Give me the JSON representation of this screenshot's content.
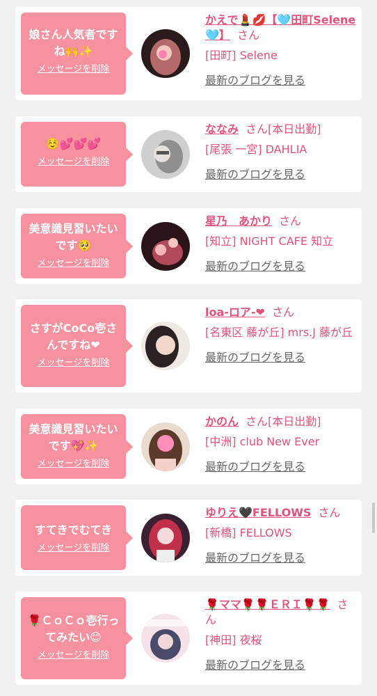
{
  "delete_label": "メッセージを削除",
  "blog_label": "最新のブログを見る",
  "honorific": "さん",
  "accent_color": "#e0537a",
  "bubble_color": "#f6919f",
  "items": [
    {
      "message": "娘さん人気者ですね🙌✨",
      "name": "かえで💄💋【🩵田町Selene🩵】",
      "status": "",
      "shop": "[田町] Selene"
    },
    {
      "message": "☺️💕💕💕",
      "name": "ななみ",
      "status": "[本日出勤]",
      "shop": "[尾張 一宮] DAHLIA"
    },
    {
      "message": "美意識見習いたいです🥺",
      "name": "星乃　あかり",
      "status": "",
      "shop": "[知立] NIGHT CAFE 知立"
    },
    {
      "message": "さすがCoCo壱さんですね❤",
      "name": "loa-ロア-❤",
      "status": "",
      "shop": "[名東区 藤が丘] mrs.J 藤が丘"
    },
    {
      "message": "美意識見習いたいです💖✨",
      "name": "かのん",
      "status": "[本日出勤]",
      "shop": "[中洲] club New Ever"
    },
    {
      "message": "すてきでむてき",
      "name": "ゆりえ🖤FELLOWS",
      "status": "",
      "shop": "[新橋] FELLOWS"
    },
    {
      "message": "🌹ＣｏＣｏ壱行ってみたい😊",
      "name": "🌹ママ🌹🌹ＥＲＩ🌹🌹",
      "status": "",
      "shop": "[神田] 夜桜"
    }
  ]
}
